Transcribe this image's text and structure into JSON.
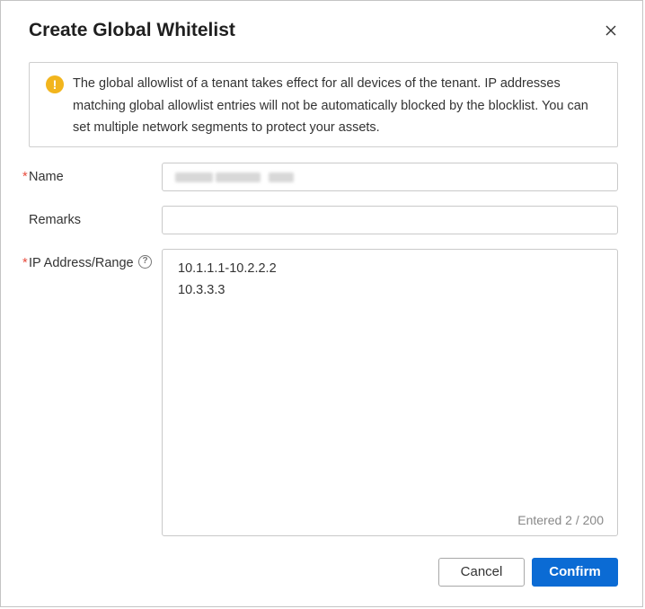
{
  "dialog": {
    "title": "Create Global Whitelist",
    "close_icon": "close-icon"
  },
  "notice": {
    "icon": "warning-icon",
    "icon_glyph": "!",
    "icon_color": "#f2b51d",
    "text": "The global allowlist of a tenant takes effect for all devices of the tenant. IP addresses matching global allowlist entries will not be automatically blocked by the blocklist. You can set multiple network segments to protect your assets."
  },
  "form": {
    "required_marker": "*",
    "name": {
      "label": "Name",
      "required": true,
      "value_redacted": true
    },
    "remarks": {
      "label": "Remarks",
      "value": ""
    },
    "ip": {
      "label": "IP Address/Range",
      "required": true,
      "help_icon": "question-circle-icon",
      "help_glyph": "?",
      "lines": [
        "10.1.1.1-10.2.2.2",
        "10.3.3.3"
      ],
      "counter": "Entered 2 / 200"
    }
  },
  "buttons": {
    "cancel_label": "Cancel",
    "confirm_label": "Confirm",
    "confirm_color": "#0b6bd4"
  }
}
